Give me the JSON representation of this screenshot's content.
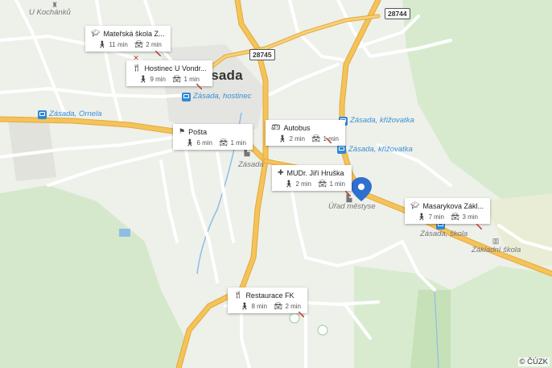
{
  "map": {
    "town_name": "Zásada",
    "places": {
      "u_kochanku": "U Kochánků",
      "zasada_place": "Zásada",
      "urad_mestyse": "Úřad městyse",
      "zasada_skola": "Zásada, škola",
      "zakladni_skola": "Základní škola"
    },
    "bus_stops": {
      "hostinec": "Zásada, hostinec",
      "ornela": "Zásada, Ornela",
      "krizovatka_1": "Zásada, křižovatka",
      "krizovatka_2": "Zásada, křižovatka"
    },
    "roads": {
      "r28744": "28744",
      "r28745": "28745"
    },
    "copyright": "© ČÚZK"
  },
  "cards": [
    {
      "id": "materska",
      "icon": "school-icon",
      "title": "Mateřská škola Z...",
      "walk": "11 min",
      "drive": "2 min"
    },
    {
      "id": "hostinec",
      "icon": "restaurant-icon",
      "title": "Hostinec U Vondr...",
      "walk": "9 min",
      "drive": "1 min"
    },
    {
      "id": "posta",
      "icon": "post-office-icon",
      "title": "Pošta",
      "walk": "6 min",
      "drive": "1 min"
    },
    {
      "id": "autobus",
      "icon": "bus-icon",
      "title": "Autobus",
      "walk": "2 min",
      "drive": "1 min"
    },
    {
      "id": "mudr",
      "icon": "medical-icon",
      "title": "MUDr. Jiří Hruška",
      "walk": "2 min",
      "drive": "1 min"
    },
    {
      "id": "masarykova",
      "icon": "school-icon",
      "title": "Masarykova Zákl...",
      "walk": "7 min",
      "drive": "3 min"
    },
    {
      "id": "restaurace",
      "icon": "restaurant-icon",
      "title": "Restaurace FK",
      "walk": "8 min",
      "drive": "2 min"
    }
  ],
  "colors": {
    "main_road": "#f4c35a",
    "main_road_edge": "#e3a93a",
    "minor_road": "#ffffff",
    "forest": "#cfe5c4",
    "background": "#eef0ea",
    "bus_stop": "#2f89d8",
    "pin": "#2f6fd0"
  }
}
